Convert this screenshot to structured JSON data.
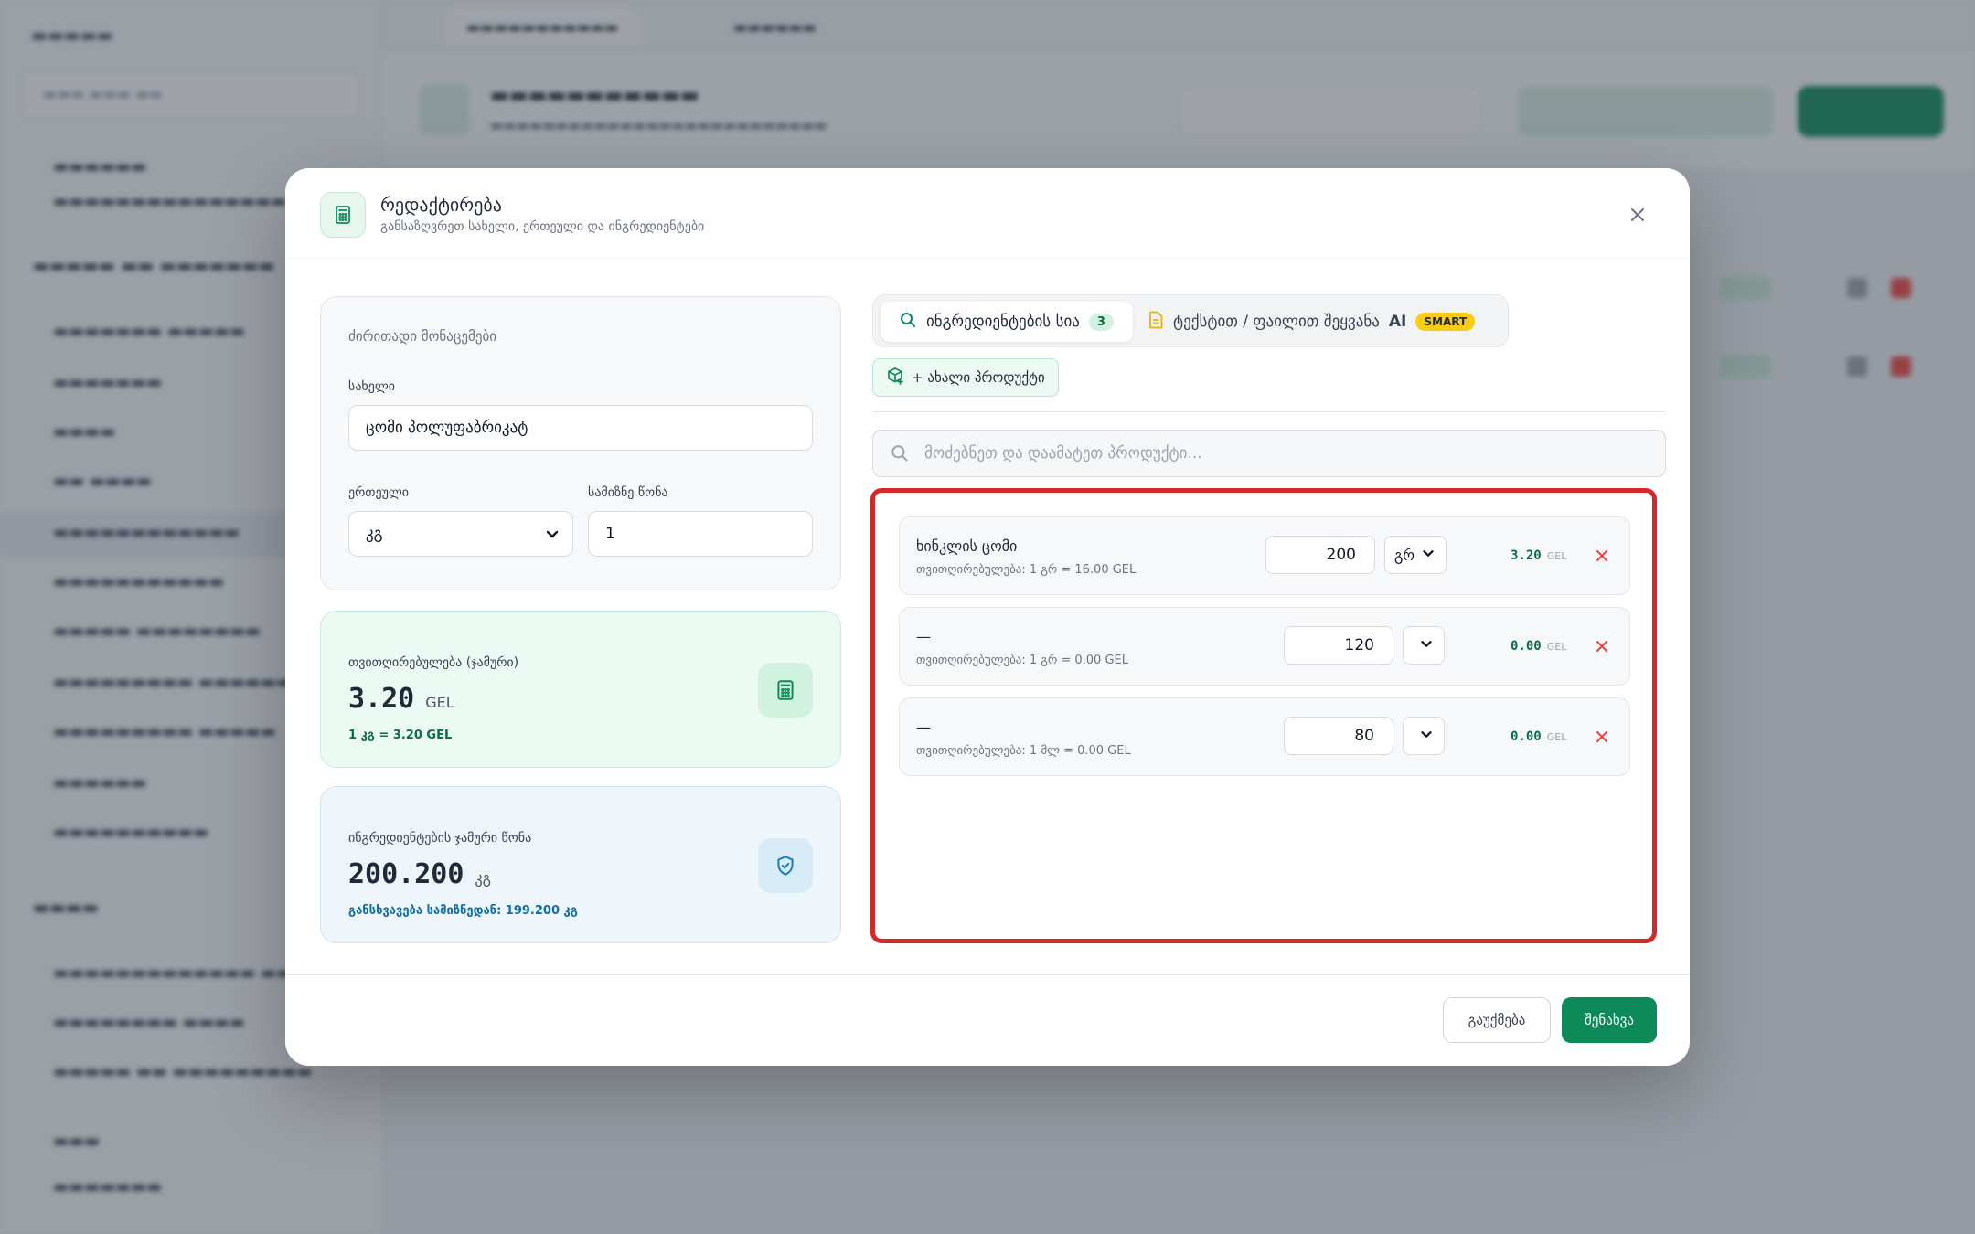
{
  "modal": {
    "title": "რედაქტირება",
    "subtitle": "განსაზღვრეთ სახელი, ერთეული და ინგრედიენტები",
    "basic": {
      "section_title": "ძირითადი მონაცემები",
      "name_label": "სახელი",
      "name_value": "ცომი პოლუფაბრიკატ",
      "unit_label": "ერთეული",
      "unit_value": "კგ",
      "yield_label": "სამიზნე წონა",
      "yield_value": "1"
    },
    "cost_card": {
      "label": "თვითღირებულება (ჯამური)",
      "value": "3.20",
      "unit": "GEL",
      "note": "1 კგ = 3.20 GEL"
    },
    "weight_card": {
      "label": "ინგრედიენტების ჯამური წონა",
      "value": "200.200",
      "unit": "კგ",
      "note": "განსხვავება სამიზნედან: 199.200 კგ"
    },
    "tabs": {
      "ingredients_label": "ინგრედიენტების სია",
      "ingredients_count": "3",
      "ai_label": "ტექსტით / ფაილით შეყვანა",
      "ai_word": "AI",
      "smart_badge": "SMART"
    },
    "new_product_label": "+ ახალი პროდუქტი",
    "search_placeholder": "მოძებნეთ და დაამატეთ პროდუქტი...",
    "ingredients": [
      {
        "name": "ხინკლის ცომი",
        "cost_line": "თვითღირებულება: 1 გრ = 16.00 GEL",
        "qty": "200",
        "unit": "გრ",
        "total": "3.20",
        "currency": "GEL"
      },
      {
        "name": "—",
        "cost_line": "თვითღირებულება: 1 გრ = 0.00 GEL",
        "qty": "120",
        "unit": "",
        "total": "0.00",
        "currency": "GEL"
      },
      {
        "name": "—",
        "cost_line": "თვითღირებულება: 1 მლ = 0.00 GEL",
        "qty": "80",
        "unit": "",
        "total": "0.00",
        "currency": "GEL"
      }
    ],
    "cancel_label": "გაუქმება",
    "save_label": "შენახვა"
  },
  "colors": {
    "accent": "#0d8a5a",
    "highlight_border": "#d72828",
    "smart_badge": "#facc15"
  },
  "icons": [
    "calculator-icon",
    "close-icon",
    "search-icon",
    "document-icon",
    "box-plus-icon",
    "shield-check-icon",
    "chevron-down-icon",
    "x-icon"
  ]
}
